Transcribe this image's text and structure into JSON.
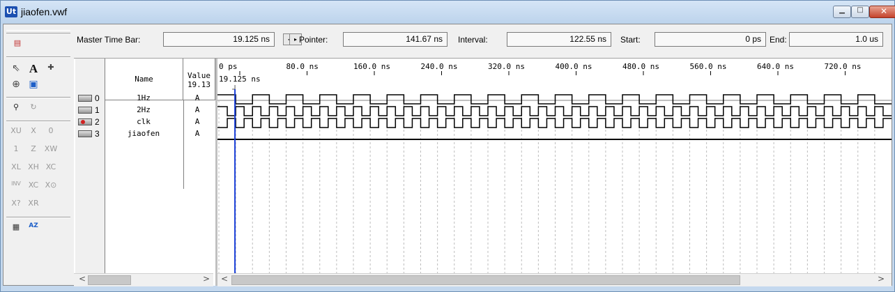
{
  "window": {
    "title": "jiaofen.vwf",
    "app_icon_label": "Ut"
  },
  "toolbar": {
    "master_time_bar_label": "Master Time Bar:",
    "master_time_bar_value": "19.125 ns",
    "pointer_label": "Pointer:",
    "pointer_value": "141.67 ns",
    "interval_label": "Interval:",
    "interval_value": "122.55 ns",
    "start_label": "Start:",
    "start_value": "0 ps",
    "end_label": "End:",
    "end_value": "1.0 us"
  },
  "tools": {
    "pointer": "⇖",
    "text": "A",
    "node": "✚",
    "zoom": "⊕",
    "fullscreen": "▣",
    "find": "⚲",
    "replace": "↻",
    "uninit": "XU",
    "unknown": "X",
    "low": "0",
    "high": "1",
    "highz": "Z",
    "weaklow": "XW",
    "weakhigh": "XL",
    "value": "XH",
    "dontcare": "XC",
    "invert": "INV",
    "count": "XC",
    "clock": "X⊙",
    "arbitrary": "X?",
    "random": "XR",
    "grid": "▦",
    "sort": "AZ"
  },
  "table": {
    "col_name": "Name",
    "col_value": "Value",
    "col_value_sub": "19.13",
    "rows": [
      {
        "index": "0",
        "name": "1Hz",
        "value": "A",
        "pin_type": "in"
      },
      {
        "index": "1",
        "name": "2Hz",
        "value": "A",
        "pin_type": "in"
      },
      {
        "index": "2",
        "name": "clk",
        "value": "A",
        "pin_type": "clk"
      },
      {
        "index": "3",
        "name": "jiaofen",
        "value": "A",
        "pin_type": "out"
      }
    ]
  },
  "timeline": {
    "ticks": [
      "0 ps",
      "80.0 ns",
      "160.0 ns",
      "240.0 ns",
      "320.0 ns",
      "400.0 ns",
      "480.0 ns",
      "560.0 ns",
      "640.0 ns",
      "720.0 ns"
    ],
    "marker_label": "19.125 ns",
    "master_time_ns": 19.125,
    "ns_per_tick": 80
  },
  "waves": [
    {
      "name": "1Hz",
      "period_ns": 40,
      "high_first": true
    },
    {
      "name": "2Hz",
      "period_ns": 20,
      "high_first": true
    },
    {
      "name": "clk",
      "period_ns": 20,
      "high_first": false
    },
    {
      "name": "jiaofen",
      "constant": "low"
    }
  ],
  "colors": {
    "master_bar": "#1a3fd8",
    "wave": "#000000",
    "grid": "#bdbdbd"
  }
}
